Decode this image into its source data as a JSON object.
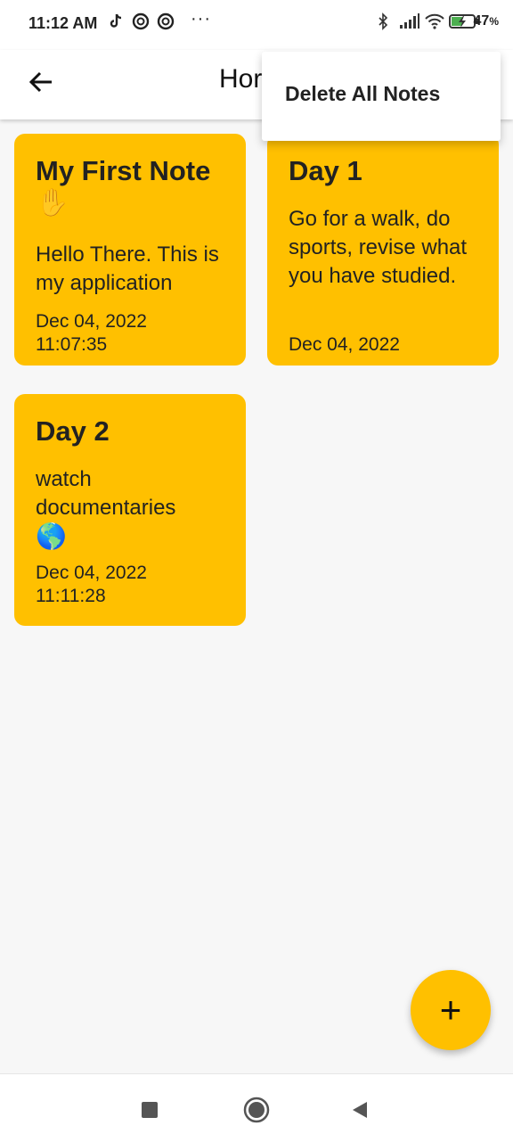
{
  "status": {
    "time": "11:12 AM",
    "dots": "···",
    "battery": "47",
    "battery_unit": "%"
  },
  "app_bar": {
    "title": "Hor",
    "back_icon": "arrow-left-icon"
  },
  "menu": {
    "items": [
      {
        "label": "Delete All Notes"
      }
    ]
  },
  "notes": [
    {
      "title": "My First Note",
      "emoji": "✋",
      "body": "Hello There. This is my application",
      "date": "Dec 04, 2022",
      "time": "11:07:35"
    },
    {
      "title": "Day 1",
      "body": "Go for a walk, do sports, revise what you have studied.",
      "date": "Dec 04, 2022"
    },
    {
      "title": "Day 2",
      "body": "watch documentaries",
      "emoji": "🌎",
      "date": "Dec 04, 2022",
      "time": "11:11:28"
    }
  ],
  "fab": {
    "label": "+"
  },
  "colors": {
    "accent": "#ffc000",
    "background": "#f7f7f7"
  }
}
